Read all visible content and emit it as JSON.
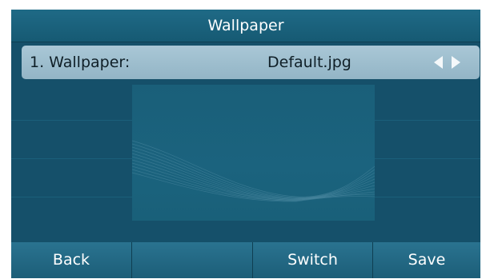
{
  "title": "Wallpaper",
  "setting": {
    "label": "1. Wallpaper:",
    "value": "Default.jpg"
  },
  "softkeys": [
    "Back",
    "",
    "Switch",
    "Save"
  ],
  "colors": {
    "screen_bg": "#15506a",
    "selected_row": "#a9c7d6",
    "softkey_bg": "#2a7390",
    "text": "#ffffff"
  }
}
